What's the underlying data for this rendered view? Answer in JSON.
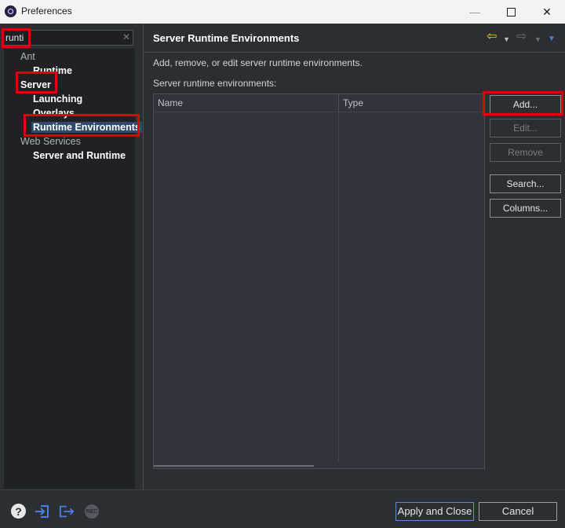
{
  "window": {
    "title": "Preferences",
    "minimize_glyph": "—",
    "close_glyph": "✕"
  },
  "filter": {
    "value": "runti",
    "clear_glyph": "✕"
  },
  "tree": {
    "items": [
      {
        "label": "Ant"
      },
      {
        "label": "Runtime"
      },
      {
        "label": "Server"
      },
      {
        "label": "Launching"
      },
      {
        "label": "Overlays"
      },
      {
        "label": "Runtime Environments"
      },
      {
        "label": "Web Services"
      },
      {
        "label": "Server and Runtime"
      }
    ]
  },
  "page": {
    "title": "Server Runtime Environments",
    "description": "Add, remove, or edit server runtime environments.",
    "list_label": "Server runtime environments:",
    "columns": [
      "Name",
      "Type"
    ],
    "rows": []
  },
  "nav": {
    "back_glyph": "⇦",
    "forward_glyph": "⇨",
    "dropdown_glyph": "▼"
  },
  "buttons": {
    "add": "Add...",
    "edit": "Edit...",
    "remove": "Remove",
    "search": "Search...",
    "columns": "Columns..."
  },
  "footer": {
    "help_glyph": "?",
    "rec_label": "REC",
    "apply_close": "Apply and Close",
    "cancel": "Cancel"
  },
  "colors": {
    "highlight": "#e0000d",
    "accent": "#4a7fe0",
    "back_arrow": "#f1c232"
  }
}
